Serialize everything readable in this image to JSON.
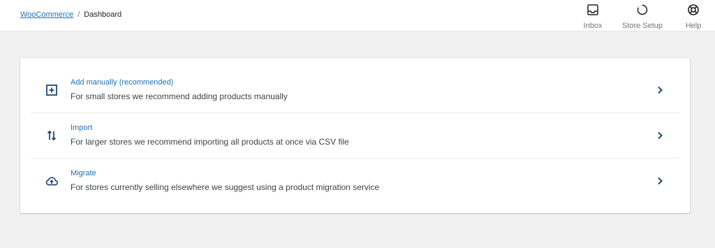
{
  "breadcrumb": {
    "parent": "WooCommerce",
    "separator": "/",
    "current": "Dashboard"
  },
  "topnav": {
    "items": [
      {
        "label": "Inbox",
        "icon": "inbox-icon"
      },
      {
        "label": "Store Setup",
        "icon": "progress-circle-icon"
      },
      {
        "label": "Help",
        "icon": "help-lifebuoy-icon"
      }
    ]
  },
  "options": [
    {
      "title": "Add manually (recommended)",
      "description": "For small stores we recommend adding products manually",
      "icon": "add-box-icon"
    },
    {
      "title": "Import",
      "description": "For larger stores we recommend importing all products at once via CSV file",
      "icon": "swap-arrows-icon"
    },
    {
      "title": "Migrate",
      "description": "For stores currently selling elsewhere we suggest using a product migration service",
      "icon": "cloud-upload-icon"
    }
  ],
  "colors": {
    "accent": "#2271b1",
    "icon_dark": "#1e4a73",
    "background": "#f1f1f1"
  }
}
